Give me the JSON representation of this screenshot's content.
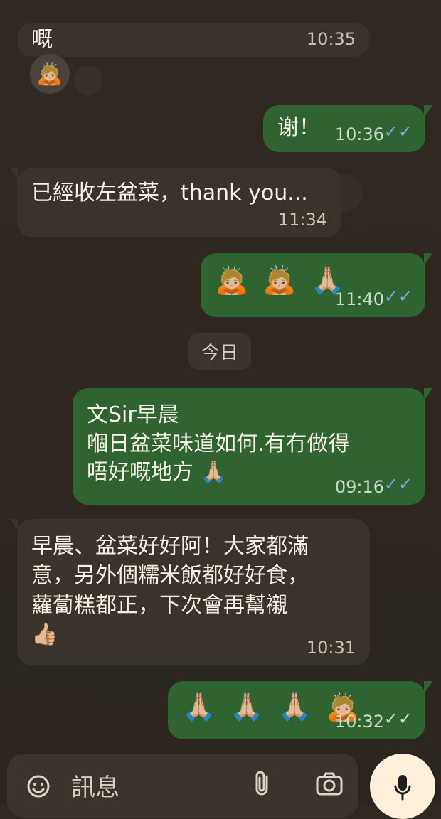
{
  "messages": {
    "m0": {
      "text": "嘅",
      "time": "10:35"
    },
    "m1": {
      "text": "谢！",
      "time": "10:36"
    },
    "m2": {
      "text": "已經收左盆菜，thank you...",
      "time": "11:34"
    },
    "m3": {
      "emoji": "🙇🏼 🙇🏼 🙏🏼",
      "time": "11:40"
    },
    "m4": {
      "text": "文Sir早晨\n嗰日盆菜味道如何.有冇做得\n唔好嘅地方 🙏🏼",
      "time": "09:16"
    },
    "m5": {
      "text": "早晨、盆菜好好阿！大家都滿\n意，另外個糯米飯都好好食，\n蘿蔔糕都正，下次會再幫襯\n👍🏼",
      "time": "10:31"
    },
    "m6": {
      "emoji": "🙏🏼 🙏🏼 🙏🏼 🙇🏼",
      "time": "10:32"
    }
  },
  "avatar_emoji": "🙇🏼",
  "day_separator": "今日",
  "composer": {
    "placeholder": "訊息",
    "sticker_icon": "sticker-icon",
    "attach_icon": "paperclip-icon",
    "camera_icon": "camera-icon",
    "mic_icon": "microphone-icon"
  }
}
